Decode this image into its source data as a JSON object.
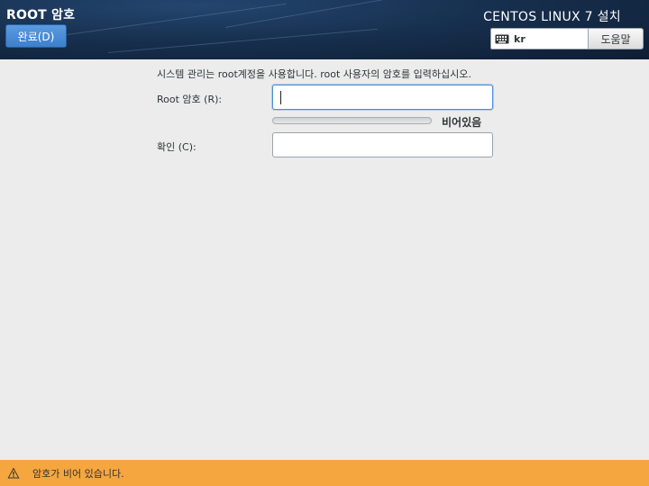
{
  "header": {
    "title": "ROOT 암호",
    "done_label": "완료(D)",
    "install_title": "CENTOS LINUX 7 설치",
    "keyboard_layout": "kr",
    "help_label": "도움말"
  },
  "form": {
    "instruction": "시스템 관리는 root계정을 사용합니다. root 사용자의 암호를 입력하십시오.",
    "root_password_label": "Root 암호 (R):",
    "root_password_value": "",
    "strength_fraction": 0,
    "strength_label": "비어있음",
    "confirm_label": "확인 (C):",
    "confirm_value": ""
  },
  "status": {
    "message": "암호가 비어 있습니다.",
    "color": "#f6a63f",
    "icon": "warning-icon"
  },
  "colors": {
    "accent": "#3d7fcb",
    "header_bg": "#17304f"
  }
}
